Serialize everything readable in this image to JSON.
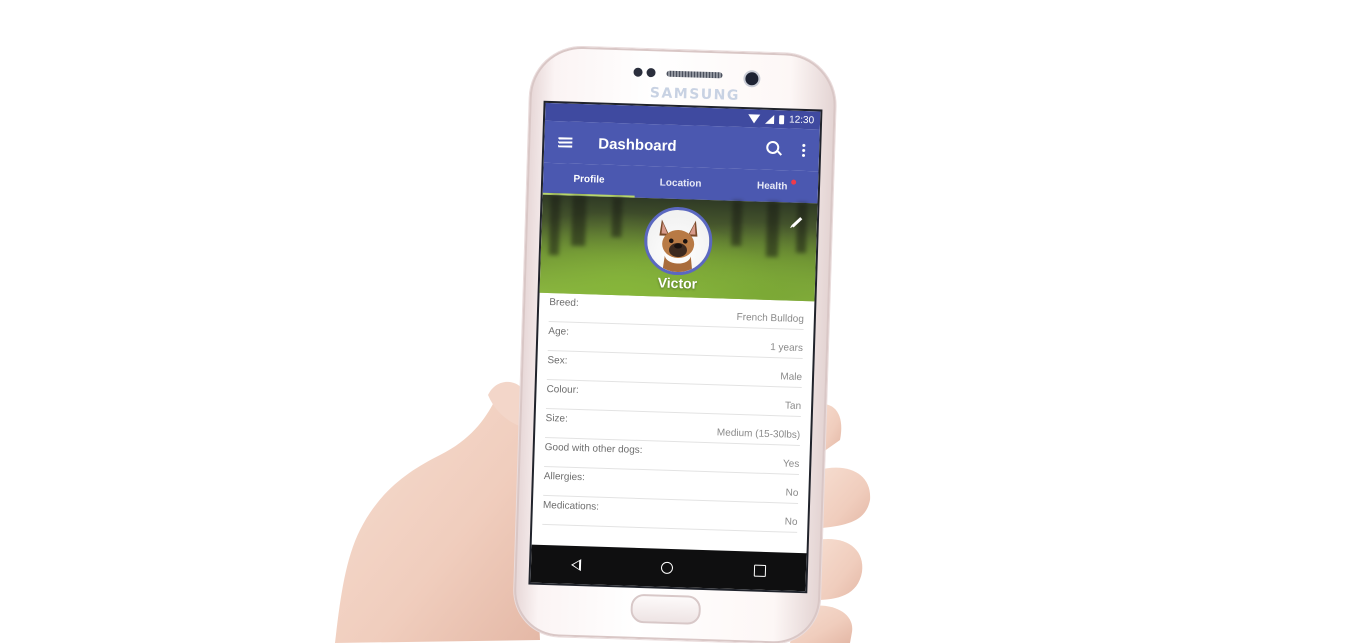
{
  "device": {
    "brand": "SAMSUNG"
  },
  "status_bar": {
    "time": "12:30"
  },
  "app_bar": {
    "title": "Dashboard",
    "icons": [
      "menu-icon",
      "search-icon",
      "more-vert-icon"
    ]
  },
  "tabs": [
    {
      "label": "Profile",
      "active": true
    },
    {
      "label": "Location",
      "active": false
    },
    {
      "label": "Health",
      "active": false,
      "badge": true
    }
  ],
  "profile": {
    "name": "Victor",
    "edit_icon": "pencil-icon",
    "details": [
      {
        "label": "Breed:",
        "value": "French Bulldog"
      },
      {
        "label": "Age:",
        "value": "1 years"
      },
      {
        "label": "Sex:",
        "value": "Male"
      },
      {
        "label": "Colour:",
        "value": "Tan"
      },
      {
        "label": "Size:",
        "value": "Medium (15-30lbs)"
      },
      {
        "label": "Good with other dogs:",
        "value": "Yes"
      },
      {
        "label": "Allergies:",
        "value": "No"
      },
      {
        "label": "Medications:",
        "value": "No"
      }
    ]
  },
  "nav_bar": {
    "icons": [
      "back-icon",
      "home-icon",
      "recents-icon"
    ]
  },
  "colors": {
    "primary": "#4b58b0",
    "status_bar": "#3f4aa0",
    "tab_indicator": "#b9d86a",
    "badge": "#f03a4a"
  }
}
